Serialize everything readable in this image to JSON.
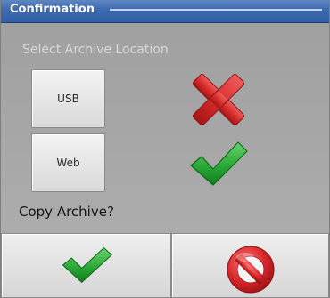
{
  "window": {
    "title": "Confirmation"
  },
  "archive": {
    "section_label": "Select Archive Location",
    "locations": [
      {
        "label": "USB",
        "status_icon": "red-x-icon"
      },
      {
        "label": "Web",
        "status_icon": "green-check-icon"
      }
    ]
  },
  "prompt": {
    "question": "Copy Archive?"
  },
  "actions": {
    "confirm_icon": "green-check-icon",
    "cancel_icon": "cancel-icon"
  },
  "colors": {
    "titlebar": "#3f6bb0",
    "check_green": "#27a534",
    "x_red": "#d52b2b",
    "cancel_red": "#d8262a"
  }
}
